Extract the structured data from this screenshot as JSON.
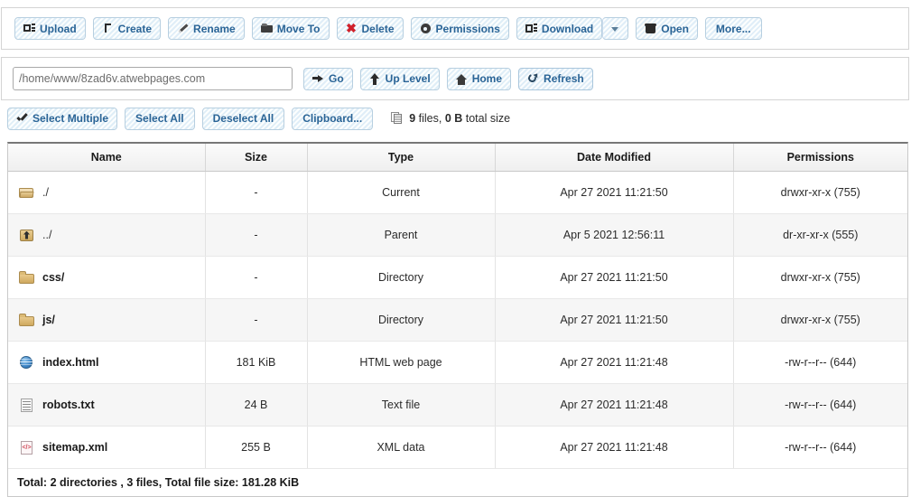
{
  "toolbar": {
    "buttons": [
      {
        "label": "Upload",
        "icon": "upload-icon"
      },
      {
        "label": "Create",
        "icon": "create-icon"
      },
      {
        "label": "Rename",
        "icon": "rename-pencil-icon"
      },
      {
        "label": "Move To",
        "icon": "move-folder-icon"
      },
      {
        "label": "Delete",
        "icon": "delete-x-icon"
      },
      {
        "label": "Permissions",
        "icon": "gear-icon"
      },
      {
        "label": "Download",
        "icon": "download-icon"
      },
      {
        "label": "Open",
        "icon": "open-box-icon"
      },
      {
        "label": "More...",
        "icon": "none"
      }
    ],
    "download_caret_icon": "chevron-down-icon"
  },
  "pathbar": {
    "path_value": "/home/www/8zad6v.atwebpages.com",
    "path_placeholder": "/home/www/",
    "go_label": "Go",
    "up_level_label": "Up Level",
    "home_label": "Home",
    "refresh_label": "Refresh"
  },
  "selection": {
    "select_multiple_label": "Select Multiple",
    "select_all_label": "Select All",
    "deselect_all_label": "Deselect All",
    "clipboard_label": "Clipboard...",
    "file_info": {
      "count": "9",
      "count_suffix": " files, ",
      "size": "0 B",
      "size_suffix": " total size"
    }
  },
  "table": {
    "columns": [
      "Name",
      "Size",
      "Type",
      "Date Modified",
      "Permissions"
    ],
    "rows": [
      {
        "icon": "folder-open-icon",
        "name": "./",
        "size": "-",
        "type": "Current",
        "date": "Apr 27 2021 11:21:50",
        "permissions": "drwxr-xr-x (755)"
      },
      {
        "icon": "folder-parent-up-icon",
        "name": "../",
        "size": "-",
        "type": "Parent",
        "date": "Apr 5 2021 12:56:11",
        "permissions": "dr-xr-xr-x (555)"
      },
      {
        "icon": "folder-icon",
        "name": "css/",
        "size": "-",
        "type": "Directory",
        "date": "Apr 27 2021 11:21:50",
        "permissions": "drwxr-xr-x (755)"
      },
      {
        "icon": "folder-icon",
        "name": "js/",
        "size": "-",
        "type": "Directory",
        "date": "Apr 27 2021 11:21:50",
        "permissions": "drwxr-xr-x (755)"
      },
      {
        "icon": "html-globe-icon",
        "name": "index.html",
        "size": "181 KiB",
        "type": "HTML web page",
        "date": "Apr 27 2021 11:21:48",
        "permissions": "-rw-r--r-- (644)"
      },
      {
        "icon": "text-file-icon",
        "name": "robots.txt",
        "size": "24 B",
        "type": "Text file",
        "date": "Apr 27 2021 11:21:48",
        "permissions": "-rw-r--r-- (644)"
      },
      {
        "icon": "xml-code-icon",
        "name": "sitemap.xml",
        "size": "255 B",
        "type": "XML data",
        "date": "Apr 27 2021 11:21:48",
        "permissions": "-rw-r--r-- (644)"
      }
    ],
    "total_line": "Total: 2 directories , 3 files, Total file size: 181.28 KiB"
  },
  "colors": {
    "button_text": "#2a6496",
    "button_bg": "#eef6fb",
    "button_border": "#b7cfe0",
    "delete_icon": "#d0202a",
    "folder": "#cfa95f",
    "html_icon": "#3d85c6",
    "xml_icon": "#d04a5a"
  }
}
